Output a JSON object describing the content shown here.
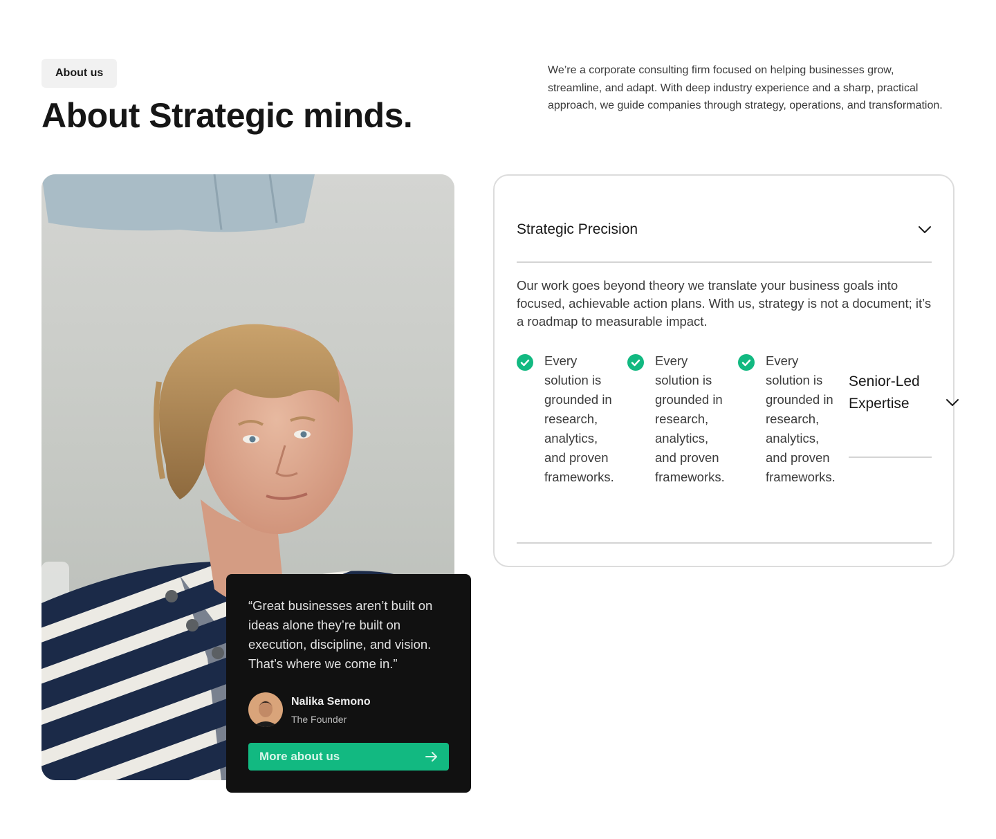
{
  "header": {
    "badge": "About us",
    "title": "About Strategic minds.",
    "intro": "We’re a corporate consulting firm focused on helping businesses grow, streamline, and adapt. With deep industry experience and a sharp, practical approach, we guide companies through strategy, operations, and transformation."
  },
  "quote_card": {
    "quote": "“Great businesses aren’t built on ideas alone they’re built on execution, discipline, and vision. That’s where we come in.”",
    "author_name": "Nalika Semono",
    "author_role": "The Founder",
    "cta_label": "More about us",
    "cta_icon": "arrow-right-icon"
  },
  "accordion": {
    "open_item": {
      "title": "Strategic Precision",
      "body": "Our work goes beyond theory we translate your business goals into focused, achievable action plans. With us, strategy is not a document; it’s a roadmap to measurable impact.",
      "features": [
        "Every solution is grounded in research, analytics, and proven frameworks.",
        "Every solution is grounded in research, analytics, and proven frameworks.",
        "Every solution is grounded in research, analytics, and proven frameworks."
      ]
    },
    "next_item": {
      "title": "Senior-Led Expertise"
    }
  },
  "colors": {
    "accent": "#12b981",
    "dark_card": "#111111",
    "badge_bg": "#f1f1f1",
    "border": "#dcdcdc"
  }
}
